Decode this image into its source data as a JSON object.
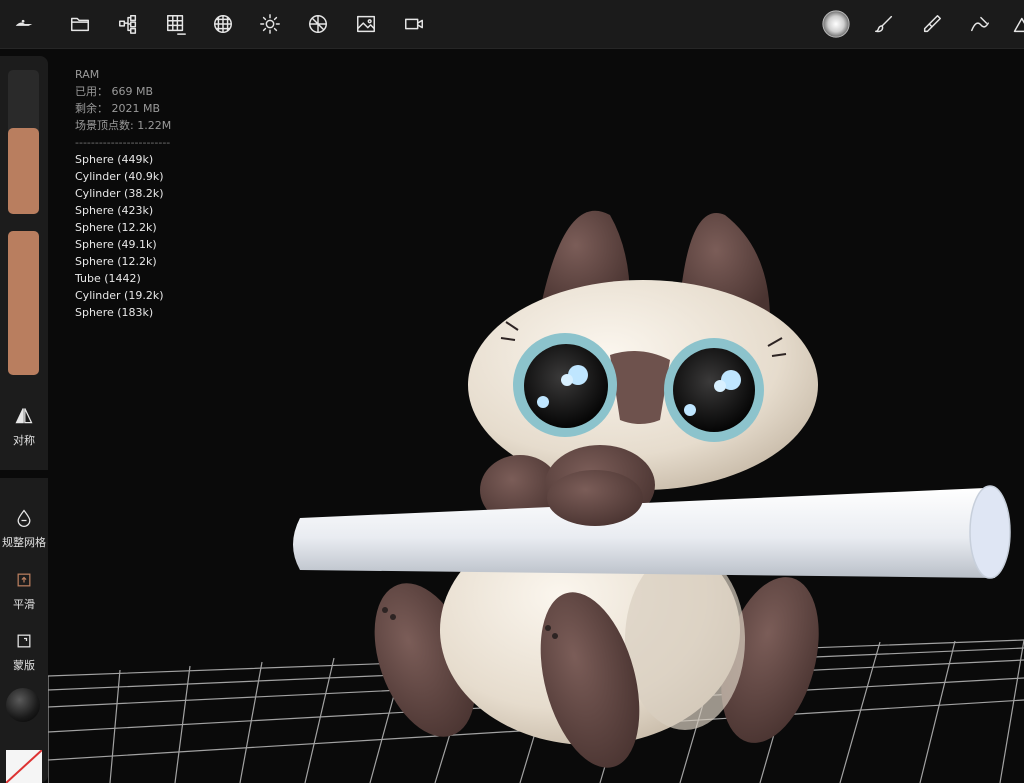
{
  "toolbar": {
    "left_icons": [
      "menu-icon",
      "folder-icon",
      "scene-tree-icon",
      "grid-icon",
      "topology-icon",
      "light-icon",
      "material-icon",
      "background-image-icon",
      "camera-icon"
    ],
    "right_icons": [
      "brush-preview-icon",
      "paint-brush-icon",
      "sculpt-brush-icon",
      "stroke-icon"
    ]
  },
  "sidebar": {
    "slider1_value": 0.6,
    "slider2_value": 1.0,
    "symmetry_label": "对称",
    "remesh_label": "规整网格",
    "smooth_label": "平滑",
    "mask_label": "蒙版"
  },
  "stats": {
    "title": "RAM",
    "used": "已用： 669 MB",
    "free": "剩余： 2021 MB",
    "vertices": "场景顶点数: 1.22M",
    "separator": "------------------------"
  },
  "objects": [
    "Sphere (449k)",
    "Cylinder (40.9k)",
    "Cylinder (38.2k)",
    "Sphere (423k)",
    "Sphere (12.2k)",
    "Sphere (49.1k)",
    "Sphere (12.2k)",
    "Tube (1442)",
    "Cylinder (19.2k)",
    "Sphere (183k)"
  ],
  "colors": {
    "accent": "#b97e5f",
    "cat_body": "#ece3d6",
    "cat_points": "#5e4440",
    "eye_ring": "#7fb8c4",
    "rod": "#eef1f6"
  }
}
